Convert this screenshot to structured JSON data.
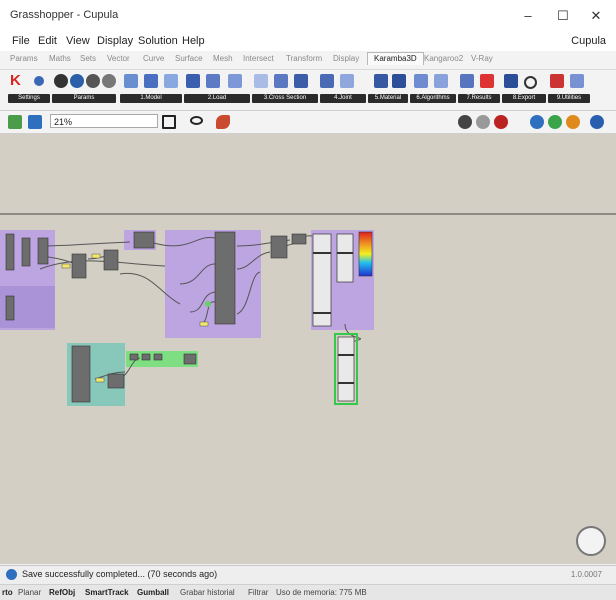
{
  "window": {
    "title": "Grasshopper - Cupula",
    "minimize": "–",
    "maximize": "☐",
    "close": "✕"
  },
  "menu": {
    "items": [
      "File",
      "Edit",
      "View",
      "Display",
      "Solution",
      "Help"
    ],
    "doc_name": "Cupula"
  },
  "tabs": {
    "items": [
      "Params",
      "Maths",
      "Sets",
      "Vector",
      "Curve",
      "Surface",
      "Mesh",
      "Intersect",
      "Transform",
      "Display",
      "Karamba3D",
      "Kangaroo2",
      "V-Ray"
    ],
    "active_index": 10
  },
  "ribbon_groups": [
    "Settings",
    "Params",
    "1.Model",
    "2.Load",
    "3.Cross Section",
    "4.Joint",
    "5.Material",
    "6.Algorithms",
    "7.Results",
    "8.Export",
    "9.Utilities"
  ],
  "canvas_toolbar": {
    "zoom": "21%"
  },
  "status": {
    "message": "Save successfully completed... (70 seconds ago)",
    "version": "1.0.0007"
  },
  "rhino_bar": {
    "items": [
      {
        "label": "rto",
        "bold": true
      },
      {
        "label": "Planar",
        "bold": false
      },
      {
        "label": "RefObj",
        "bold": true
      },
      {
        "label": "SmartTrack",
        "bold": true
      },
      {
        "label": "Gumball",
        "bold": true
      },
      {
        "label": "Grabar historial",
        "bold": false
      },
      {
        "label": "Filtrar",
        "bold": false
      },
      {
        "label": "Uso de memoria: 775 MB",
        "bold": false
      }
    ]
  },
  "colors": {
    "canvas": "#d4cfc5",
    "group_purple": "#b99ee6",
    "group_teal": "#7fc7b8",
    "group_green": "#74e07a",
    "component": "#6d6d6d",
    "selected_outline": "#34c94a"
  }
}
